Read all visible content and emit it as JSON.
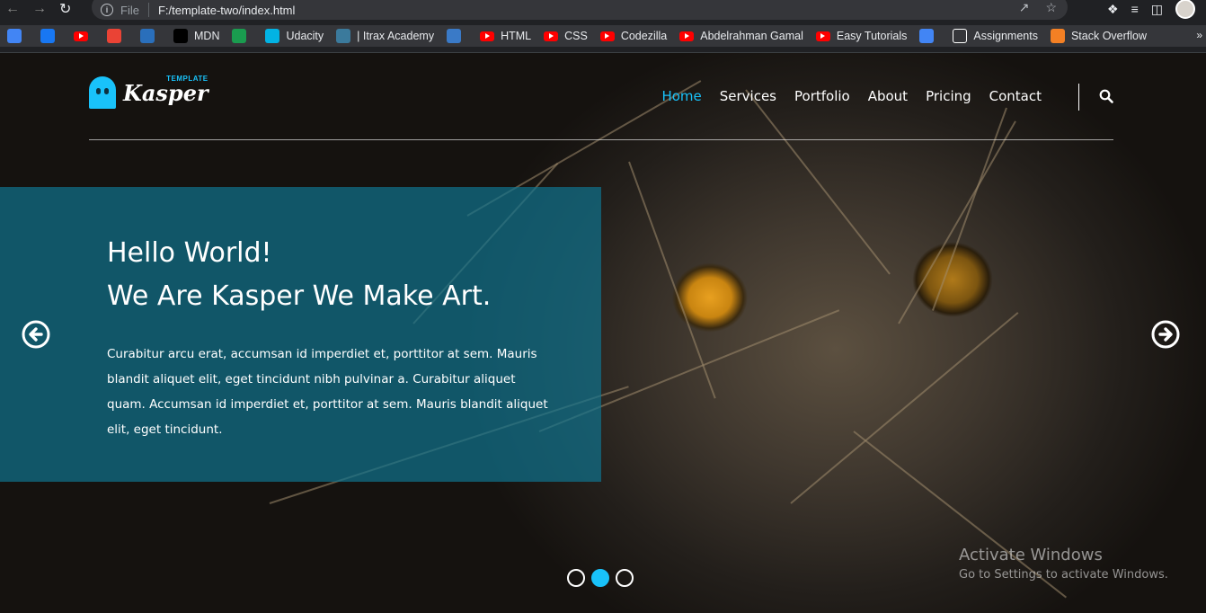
{
  "browser": {
    "url_scheme": "File",
    "url": "F:/template-two/index.html",
    "bookmarks": [
      {
        "label": "",
        "icon": "google-icon",
        "color": "#4285f4"
      },
      {
        "label": "",
        "icon": "facebook-icon",
        "color": "#1877f2"
      },
      {
        "label": "",
        "icon": "youtube-icon",
        "color": "#ff0000"
      },
      {
        "label": "",
        "icon": "gmail-icon",
        "color": "#ea4335"
      },
      {
        "label": "",
        "icon": "site-icon",
        "color": "#2a6fbb"
      },
      {
        "label": "MDN",
        "icon": "mdn-icon",
        "color": "#000000"
      },
      {
        "label": "",
        "icon": "w-icon",
        "color": "#1a9c4f"
      },
      {
        "label": "Udacity",
        "icon": "udacity-icon",
        "color": "#02b3e4"
      },
      {
        "label": "| Itrax Academy",
        "icon": "itrax-icon",
        "color": "#3b7a9c"
      },
      {
        "label": "",
        "icon": "e-icon",
        "color": "#3a7ac7"
      },
      {
        "label": "HTML",
        "icon": "youtube-icon",
        "color": "#ff0000"
      },
      {
        "label": "CSS",
        "icon": "youtube-icon",
        "color": "#ff0000"
      },
      {
        "label": "Codezilla",
        "icon": "youtube-icon",
        "color": "#ff0000"
      },
      {
        "label": "Abdelrahman Gamal",
        "icon": "youtube-icon",
        "color": "#ff0000"
      },
      {
        "label": "Easy Tutorials",
        "icon": "youtube-icon",
        "color": "#ff0000"
      },
      {
        "label": "",
        "icon": "translate-icon",
        "color": "#4285f4"
      },
      {
        "label": "Assignments",
        "icon": "assignments-icon",
        "color": "#ffffff"
      },
      {
        "label": "Stack Overflow",
        "icon": "stackoverflow-icon",
        "color": "#f48024"
      }
    ],
    "more": "»"
  },
  "site": {
    "logo_small": "TEMPLATE",
    "logo_main": "Kasper",
    "nav": [
      {
        "label": "Home",
        "active": true
      },
      {
        "label": "Services",
        "active": false
      },
      {
        "label": "Portfolio",
        "active": false
      },
      {
        "label": "About",
        "active": false
      },
      {
        "label": "Pricing",
        "active": false
      },
      {
        "label": "Contact",
        "active": false
      }
    ],
    "hero": {
      "title_line1": "Hello World!",
      "title_line2": "We Are Kasper We Make Art.",
      "text": "Curabitur arcu erat, accumsan id imperdiet et, porttitor at sem. Mauris blandit aliquet elit, eget tincidunt nibh pulvinar a. Curabitur aliquet quam. Accumsan id imperdiet et, porttitor at sem. Mauris blandit aliquet elit, eget tincidunt."
    },
    "slider": {
      "slide_count": 3,
      "active_slide": 2
    },
    "accent_color": "#19c2fa",
    "hero_box_color": "#0f748f"
  },
  "watermark": {
    "title": "Activate Windows",
    "subtitle": "Go to Settings to activate Windows."
  }
}
